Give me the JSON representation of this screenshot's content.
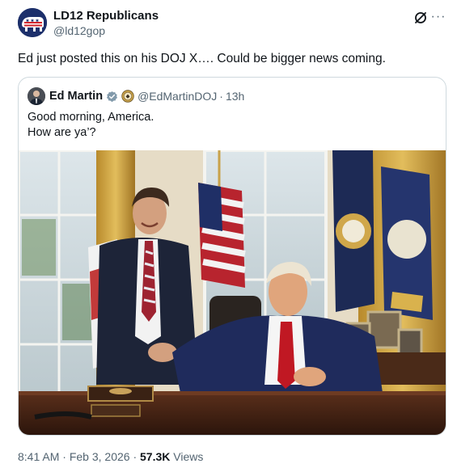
{
  "author": {
    "display_name": "LD12 Republicans",
    "handle": "@ld12gop",
    "avatar_icon": "elephant-logo-icon"
  },
  "post": {
    "text": "Ed just posted this on his DOJ X…. Could be bigger news coming."
  },
  "header_icons": {
    "grok": "grok-slash-icon",
    "more": "···"
  },
  "quoted": {
    "display_name": "Ed Martin",
    "handle": "@EdMartinDOJ",
    "dot": "·",
    "time": "13h",
    "verified_color": "#829aab",
    "lines": [
      "Good morning, America.",
      "How are ya’?"
    ],
    "image_icon": "oval-office-photo"
  },
  "meta": {
    "time": "8:41 AM",
    "sep": " · ",
    "date": "Feb 3, 2026",
    "views_count": "57.3K",
    "views_label": " Views"
  }
}
